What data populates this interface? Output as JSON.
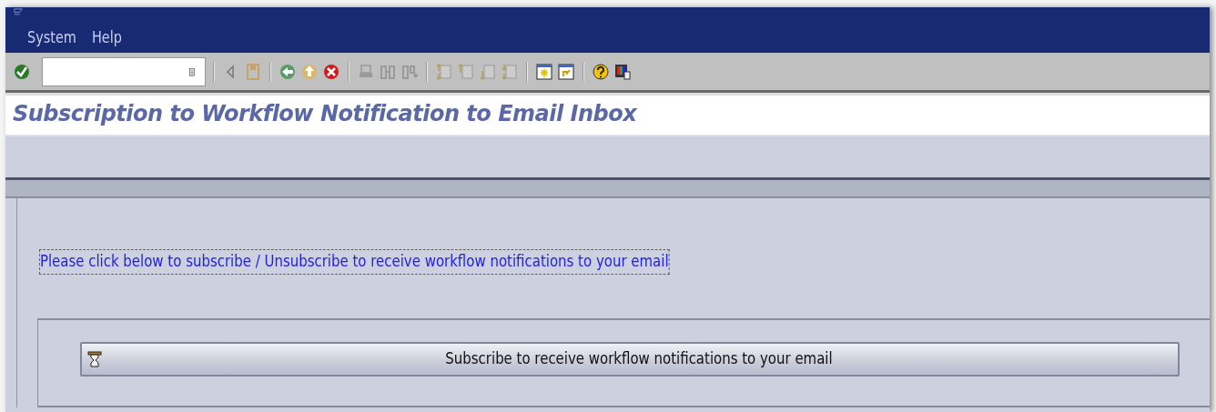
{
  "menu": [
    "System",
    "Help"
  ],
  "title": "Subscription to Workflow Notification to Email Inbox",
  "info_text": "Please click below to subscribe / Unsubscribe to receive workflow notifications to your email",
  "button": {
    "label": "Subscribe to receive workflow notifications to your email"
  }
}
